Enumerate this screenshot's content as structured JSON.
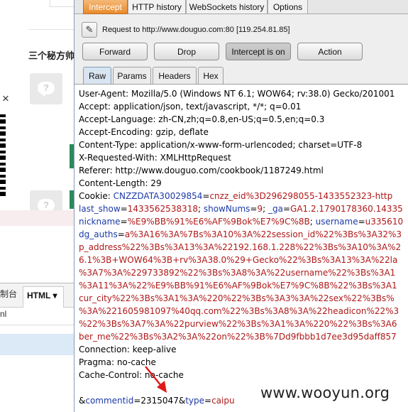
{
  "background_page": {
    "heading": "三个秘方帅",
    "close_symbol": "×",
    "devtools": {
      "tab_console": "制台",
      "tab_html": "HTML ▾",
      "content_line": "nl"
    }
  },
  "burp": {
    "tabs": [
      "Intercept",
      "HTTP history",
      "WebSockets history",
      "Options"
    ],
    "active_tab": "Intercept",
    "request_line": "Request to http://www.douguo.com:80  [119.254.81.85]",
    "buttons": {
      "forward": "Forward",
      "drop": "Drop",
      "intercept": "Intercept is on",
      "action": "Action"
    },
    "subtabs": [
      "Raw",
      "Params",
      "Headers",
      "Hex"
    ],
    "active_subtab": "Raw",
    "request": {
      "user_agent": "User-Agent: Mozilla/5.0 (Windows NT 6.1; WOW64; rv:38.0) Gecko/201001",
      "accept": "Accept: application/json, text/javascript, */*; q=0.01",
      "accept_language": "Accept-Language: zh-CN,zh;q=0.8,en-US;q=0.5,en;q=0.3",
      "accept_encoding": "Accept-Encoding: gzip, deflate",
      "content_type": "Content-Type: application/x-www-form-urlencoded; charset=UTF-8",
      "x_requested_with": "X-Requested-With: XMLHttpRequest",
      "referer": "Referer: http://www.douguo.com/cookbook/1187249.html",
      "content_length": "Content-Length: 29",
      "cookie": [
        [
          [
            "k",
            "Cookie: "
          ],
          [
            "p",
            "CNZZDATA30029854"
          ],
          [
            "k",
            "="
          ],
          [
            "v",
            "cnzz_eid%3D296298055-1433552323-http"
          ]
        ],
        [
          [
            "p",
            "last_show"
          ],
          [
            "k",
            "="
          ],
          [
            "v",
            "1433562538318"
          ],
          [
            "k",
            "; "
          ],
          [
            "p",
            "showNums"
          ],
          [
            "k",
            "="
          ],
          [
            "v",
            "9"
          ],
          [
            "k",
            "; "
          ],
          [
            "p",
            "_ga"
          ],
          [
            "k",
            "="
          ],
          [
            "v",
            "GA1.2.1790178360.14335"
          ]
        ],
        [
          [
            "p",
            "nickname"
          ],
          [
            "k",
            "="
          ],
          [
            "v",
            "%E9%BB%91%E6%AF%9Bok%E7%9C%8B"
          ],
          [
            "k",
            "; "
          ],
          [
            "p",
            "username"
          ],
          [
            "k",
            "="
          ],
          [
            "v",
            "u335610"
          ]
        ],
        [
          [
            "p",
            "dg_auths"
          ],
          [
            "k",
            "="
          ],
          [
            "v",
            "a%3A16%3A%7Bs%3A10%3A%22session_id%22%3Bs%3A32%3"
          ]
        ],
        [
          [
            "v",
            "p_address%22%3Bs%3A13%3A%22192.168.1.228%22%3Bs%3A10%3A%2"
          ]
        ],
        [
          [
            "v",
            "6.1%3B+WOW64%3B+rv%3A38.0%29+Gecko%22%3Bs%3A13%3A%22la"
          ]
        ],
        [
          [
            "v",
            "%3A7%3A%229733892%22%3Bs%3A8%3A%22username%22%3Bs%3A1"
          ]
        ],
        [
          [
            "v",
            "%3A11%3A%22%E9%BB%91%E6%AF%9Bok%E7%9C%8B%22%3Bs%3A1"
          ]
        ],
        [
          [
            "v",
            "cur_city%22%3Bs%3A1%3A%220%22%3Bs%3A3%3A%22sex%22%3Bs%"
          ]
        ],
        [
          [
            "v",
            "%3A%221605981097%40qq.com%22%3Bs%3A8%3A%22headicon%22%3"
          ]
        ],
        [
          [
            "v",
            "%22%3Bs%3A7%3A%22purview%22%3Bs%3A1%3A%220%22%3Bs%3A6"
          ]
        ],
        [
          [
            "v",
            "ber_me%22%3Bs%3A2%3A%22on%22%3B%7Dd9fbbb1d7ee3d95daff857"
          ]
        ]
      ],
      "connection": "Connection: keep-alive",
      "pragma": "Pragma: no-cache",
      "cache_control": "Cache-Control: no-cache",
      "body": [
        [
          "k",
          "&"
        ],
        [
          "p",
          "commentid"
        ],
        [
          "k",
          "=2315047&"
        ],
        [
          "p",
          "type"
        ],
        [
          "k",
          "="
        ],
        [
          "v",
          "caipu"
        ]
      ]
    },
    "colors": {
      "param_name": "#1b3aa8",
      "param_value": "#b01818",
      "annotation_arrow": "#e01818"
    }
  },
  "watermark": "www.wooyun.org"
}
